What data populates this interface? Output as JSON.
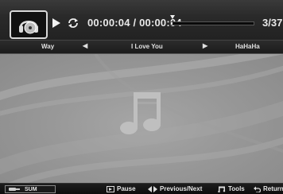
{
  "player": {
    "elapsed_time": "00:00:04",
    "total_time": "00:00:04",
    "time_separator": " / ",
    "progress": 0.02,
    "track_count": "3/37",
    "play_state": "play-icon",
    "repeat_icon": "repeat-icon",
    "album_icon": "headphones-disc-icon"
  },
  "tracks": {
    "previous_title": "Way",
    "current_title": "I Love You",
    "next_title": "HaHaHa"
  },
  "main": {
    "placeholder_icon": "music-note-icon"
  },
  "footer": {
    "sum_label": "SUM",
    "pause_label": "Pause",
    "prevnext_label": "Previous/Next",
    "tools_label": "Tools",
    "return_label": "Return"
  },
  "colors": {
    "bar_background": "#222222",
    "main_background": "#989898",
    "text": "#e8e8e8"
  }
}
